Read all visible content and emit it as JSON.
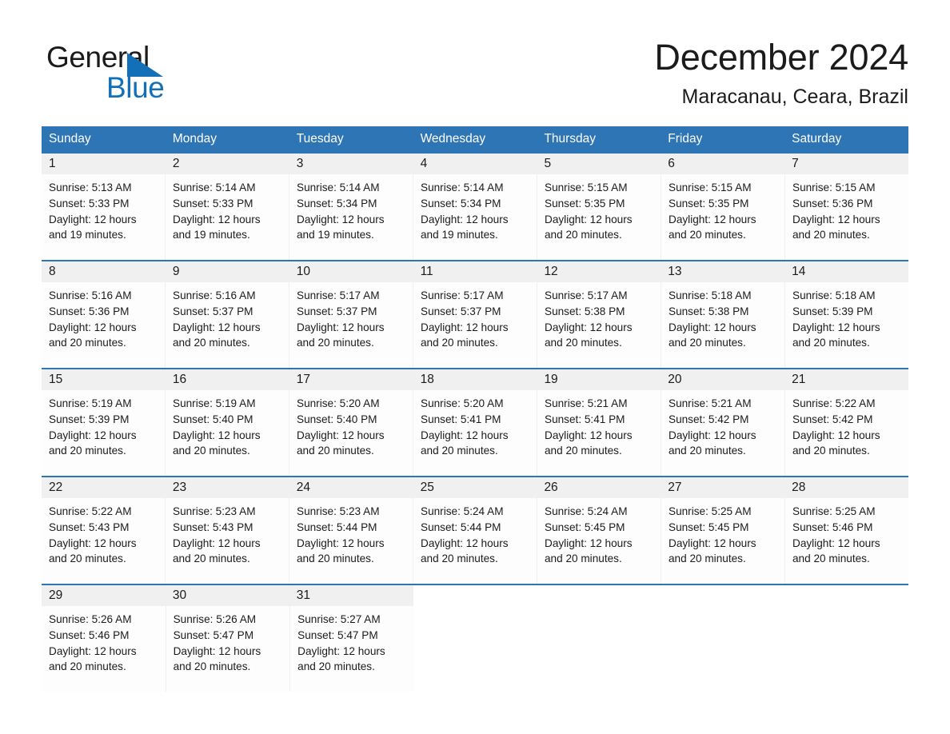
{
  "brand": {
    "logo_text_top": "General",
    "logo_text_bottom": "Blue",
    "logo_icon": "triangle-flag-icon",
    "brand_blue": "#1270b8"
  },
  "header": {
    "title": "December 2024",
    "subtitle": "Maracanau, Ceara, Brazil"
  },
  "colors": {
    "header_blue": "#2e75b6",
    "daynum_band": "#f0f0f0",
    "text": "#1b1b1b"
  },
  "weekdays": [
    "Sunday",
    "Monday",
    "Tuesday",
    "Wednesday",
    "Thursday",
    "Friday",
    "Saturday"
  ],
  "labels": {
    "sunrise_prefix": "Sunrise:",
    "sunset_prefix": "Sunset:",
    "daylight_prefix": "Daylight:"
  },
  "weeks": [
    {
      "days": [
        {
          "num": "1",
          "sunrise": "Sunrise: 5:13 AM",
          "sunset": "Sunset: 5:33 PM",
          "daylight_line1": "Daylight: 12 hours",
          "daylight_line2": "and 19 minutes."
        },
        {
          "num": "2",
          "sunrise": "Sunrise: 5:14 AM",
          "sunset": "Sunset: 5:33 PM",
          "daylight_line1": "Daylight: 12 hours",
          "daylight_line2": "and 19 minutes."
        },
        {
          "num": "3",
          "sunrise": "Sunrise: 5:14 AM",
          "sunset": "Sunset: 5:34 PM",
          "daylight_line1": "Daylight: 12 hours",
          "daylight_line2": "and 19 minutes."
        },
        {
          "num": "4",
          "sunrise": "Sunrise: 5:14 AM",
          "sunset": "Sunset: 5:34 PM",
          "daylight_line1": "Daylight: 12 hours",
          "daylight_line2": "and 19 minutes."
        },
        {
          "num": "5",
          "sunrise": "Sunrise: 5:15 AM",
          "sunset": "Sunset: 5:35 PM",
          "daylight_line1": "Daylight: 12 hours",
          "daylight_line2": "and 20 minutes."
        },
        {
          "num": "6",
          "sunrise": "Sunrise: 5:15 AM",
          "sunset": "Sunset: 5:35 PM",
          "daylight_line1": "Daylight: 12 hours",
          "daylight_line2": "and 20 minutes."
        },
        {
          "num": "7",
          "sunrise": "Sunrise: 5:15 AM",
          "sunset": "Sunset: 5:36 PM",
          "daylight_line1": "Daylight: 12 hours",
          "daylight_line2": "and 20 minutes."
        }
      ]
    },
    {
      "days": [
        {
          "num": "8",
          "sunrise": "Sunrise: 5:16 AM",
          "sunset": "Sunset: 5:36 PM",
          "daylight_line1": "Daylight: 12 hours",
          "daylight_line2": "and 20 minutes."
        },
        {
          "num": "9",
          "sunrise": "Sunrise: 5:16 AM",
          "sunset": "Sunset: 5:37 PM",
          "daylight_line1": "Daylight: 12 hours",
          "daylight_line2": "and 20 minutes."
        },
        {
          "num": "10",
          "sunrise": "Sunrise: 5:17 AM",
          "sunset": "Sunset: 5:37 PM",
          "daylight_line1": "Daylight: 12 hours",
          "daylight_line2": "and 20 minutes."
        },
        {
          "num": "11",
          "sunrise": "Sunrise: 5:17 AM",
          "sunset": "Sunset: 5:37 PM",
          "daylight_line1": "Daylight: 12 hours",
          "daylight_line2": "and 20 minutes."
        },
        {
          "num": "12",
          "sunrise": "Sunrise: 5:17 AM",
          "sunset": "Sunset: 5:38 PM",
          "daylight_line1": "Daylight: 12 hours",
          "daylight_line2": "and 20 minutes."
        },
        {
          "num": "13",
          "sunrise": "Sunrise: 5:18 AM",
          "sunset": "Sunset: 5:38 PM",
          "daylight_line1": "Daylight: 12 hours",
          "daylight_line2": "and 20 minutes."
        },
        {
          "num": "14",
          "sunrise": "Sunrise: 5:18 AM",
          "sunset": "Sunset: 5:39 PM",
          "daylight_line1": "Daylight: 12 hours",
          "daylight_line2": "and 20 minutes."
        }
      ]
    },
    {
      "days": [
        {
          "num": "15",
          "sunrise": "Sunrise: 5:19 AM",
          "sunset": "Sunset: 5:39 PM",
          "daylight_line1": "Daylight: 12 hours",
          "daylight_line2": "and 20 minutes."
        },
        {
          "num": "16",
          "sunrise": "Sunrise: 5:19 AM",
          "sunset": "Sunset: 5:40 PM",
          "daylight_line1": "Daylight: 12 hours",
          "daylight_line2": "and 20 minutes."
        },
        {
          "num": "17",
          "sunrise": "Sunrise: 5:20 AM",
          "sunset": "Sunset: 5:40 PM",
          "daylight_line1": "Daylight: 12 hours",
          "daylight_line2": "and 20 minutes."
        },
        {
          "num": "18",
          "sunrise": "Sunrise: 5:20 AM",
          "sunset": "Sunset: 5:41 PM",
          "daylight_line1": "Daylight: 12 hours",
          "daylight_line2": "and 20 minutes."
        },
        {
          "num": "19",
          "sunrise": "Sunrise: 5:21 AM",
          "sunset": "Sunset: 5:41 PM",
          "daylight_line1": "Daylight: 12 hours",
          "daylight_line2": "and 20 minutes."
        },
        {
          "num": "20",
          "sunrise": "Sunrise: 5:21 AM",
          "sunset": "Sunset: 5:42 PM",
          "daylight_line1": "Daylight: 12 hours",
          "daylight_line2": "and 20 minutes."
        },
        {
          "num": "21",
          "sunrise": "Sunrise: 5:22 AM",
          "sunset": "Sunset: 5:42 PM",
          "daylight_line1": "Daylight: 12 hours",
          "daylight_line2": "and 20 minutes."
        }
      ]
    },
    {
      "days": [
        {
          "num": "22",
          "sunrise": "Sunrise: 5:22 AM",
          "sunset": "Sunset: 5:43 PM",
          "daylight_line1": "Daylight: 12 hours",
          "daylight_line2": "and 20 minutes."
        },
        {
          "num": "23",
          "sunrise": "Sunrise: 5:23 AM",
          "sunset": "Sunset: 5:43 PM",
          "daylight_line1": "Daylight: 12 hours",
          "daylight_line2": "and 20 minutes."
        },
        {
          "num": "24",
          "sunrise": "Sunrise: 5:23 AM",
          "sunset": "Sunset: 5:44 PM",
          "daylight_line1": "Daylight: 12 hours",
          "daylight_line2": "and 20 minutes."
        },
        {
          "num": "25",
          "sunrise": "Sunrise: 5:24 AM",
          "sunset": "Sunset: 5:44 PM",
          "daylight_line1": "Daylight: 12 hours",
          "daylight_line2": "and 20 minutes."
        },
        {
          "num": "26",
          "sunrise": "Sunrise: 5:24 AM",
          "sunset": "Sunset: 5:45 PM",
          "daylight_line1": "Daylight: 12 hours",
          "daylight_line2": "and 20 minutes."
        },
        {
          "num": "27",
          "sunrise": "Sunrise: 5:25 AM",
          "sunset": "Sunset: 5:45 PM",
          "daylight_line1": "Daylight: 12 hours",
          "daylight_line2": "and 20 minutes."
        },
        {
          "num": "28",
          "sunrise": "Sunrise: 5:25 AM",
          "sunset": "Sunset: 5:46 PM",
          "daylight_line1": "Daylight: 12 hours",
          "daylight_line2": "and 20 minutes."
        }
      ]
    },
    {
      "days": [
        {
          "num": "29",
          "sunrise": "Sunrise: 5:26 AM",
          "sunset": "Sunset: 5:46 PM",
          "daylight_line1": "Daylight: 12 hours",
          "daylight_line2": "and 20 minutes."
        },
        {
          "num": "30",
          "sunrise": "Sunrise: 5:26 AM",
          "sunset": "Sunset: 5:47 PM",
          "daylight_line1": "Daylight: 12 hours",
          "daylight_line2": "and 20 minutes."
        },
        {
          "num": "31",
          "sunrise": "Sunrise: 5:27 AM",
          "sunset": "Sunset: 5:47 PM",
          "daylight_line1": "Daylight: 12 hours",
          "daylight_line2": "and 20 minutes."
        },
        {
          "num": "",
          "sunrise": "",
          "sunset": "",
          "daylight_line1": "",
          "daylight_line2": ""
        },
        {
          "num": "",
          "sunrise": "",
          "sunset": "",
          "daylight_line1": "",
          "daylight_line2": ""
        },
        {
          "num": "",
          "sunrise": "",
          "sunset": "",
          "daylight_line1": "",
          "daylight_line2": ""
        },
        {
          "num": "",
          "sunrise": "",
          "sunset": "",
          "daylight_line1": "",
          "daylight_line2": ""
        }
      ]
    }
  ]
}
